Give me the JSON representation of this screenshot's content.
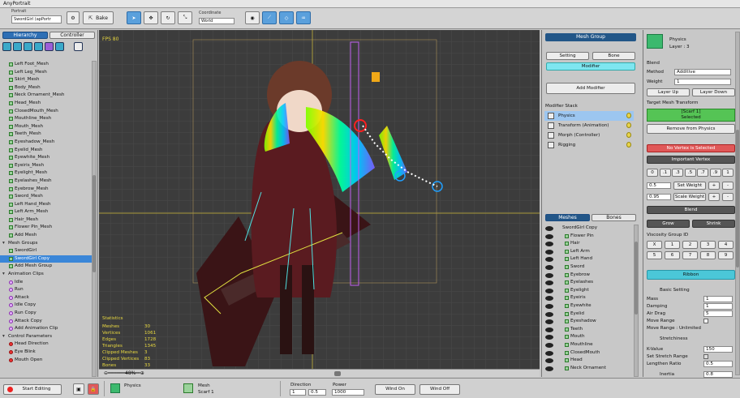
{
  "app": {
    "title": "AnyPortrait"
  },
  "toolbar": {
    "portrait_label": "Portrait",
    "portrait_value": "SwordGirl (apPortr",
    "bake_label": "Bake",
    "coordinate_label": "Coordinate",
    "coordinate_value": "World"
  },
  "left_panel": {
    "tabs": [
      "Hierarchy",
      "Controller"
    ],
    "meshes": [
      "Left Foot_Mesh",
      "Left Leg_Mesh",
      "Skirt_Mesh",
      "Body_Mesh",
      "Neck Ornament_Mesh",
      "Head_Mesh",
      "ClosedMouth_Mesh",
      "Mouthline_Mesh",
      "Mouth_Mesh",
      "Teeth_Mesh",
      "Eyeshadow_Mesh",
      "Eyelid_Mesh",
      "Eyewhite_Mesh",
      "Eyeiris_Mesh",
      "Eyelight_Mesh",
      "Eyelashes_Mesh",
      "Eyebrow_Mesh",
      "Sword_Mesh",
      "Left Hand_Mesh",
      "Left Arm_Mesh",
      "Hair_Mesh",
      "Flower Pin_Mesh",
      "Add Mesh"
    ],
    "mesh_groups_header": "Mesh Groups",
    "mesh_groups": [
      "SwordGirl",
      "SwordGirl Copy",
      "Add Mesh Group"
    ],
    "animation_header": "Animation Clips",
    "animations": [
      "Idle",
      "Run",
      "Attack",
      "Idle Copy",
      "Run Copy",
      "Attack Copy",
      "Add Animation Clip"
    ],
    "control_header": "Control Parameters",
    "controls": [
      "Head Direction",
      "Eye Blink",
      "Mouth Open"
    ]
  },
  "viewport": {
    "fps": "FPS 80",
    "zoom": "48%",
    "stats_title": "Statistics",
    "stats": [
      {
        "k": "Meshes",
        "v": "30"
      },
      {
        "k": "Vertices",
        "v": "1061"
      },
      {
        "k": "Edges",
        "v": "1728"
      },
      {
        "k": "Triangles",
        "v": "1345"
      },
      {
        "k": "Clipped Meshes",
        "v": "3"
      },
      {
        "k": "Clipped Vertices",
        "v": "83"
      },
      {
        "k": "Bones",
        "v": "33"
      }
    ]
  },
  "mid_panel": {
    "header": "Mesh Group",
    "setting_label": "Setting",
    "bone_label": "Bone",
    "modifier_label": "Modifier",
    "add_modifier_label": "Add Modifier",
    "stack_title": "Modifier Stack",
    "stack": [
      "Physics",
      "Transform (Animation)",
      "Morph (Controller)",
      "Rigging"
    ],
    "tabs": [
      "Meshes",
      "Bones"
    ],
    "tree_root": "SwordGirl Copy",
    "tree": [
      "Flower Pin",
      "Hair",
      "Left Arm",
      "Left Hand",
      "Sword",
      "Eyebrow",
      "Eyelashes",
      "Eyelight",
      "Eyeiris",
      "Eyewhite",
      "Eyelid",
      "Eyeshadow",
      "Teeth",
      "Mouth",
      "Mouthline",
      "ClosedMouth",
      "Head",
      "Neck Ornament"
    ]
  },
  "right_panel": {
    "title": "Physics",
    "layer": "Layer : 3",
    "blend_label": "Blend",
    "method_label": "Method",
    "method_value": "Additive",
    "weight_label": "Weight",
    "weight_value": "1",
    "layer_up": "Layer Up",
    "layer_down": "Layer Down",
    "target_label": "Target Mesh Transform",
    "target_value": "[Scarf 1]",
    "target_state": "Selected",
    "remove_label": "Remove from Physics",
    "no_vertex": "No Vertex is Selected",
    "important_vertex": "Important Vertex",
    "weight_steps": [
      "0",
      ".1",
      ".3",
      ".5",
      ".7",
      ".9",
      "1"
    ],
    "set_weight_value": "0.5",
    "set_weight_label": "Set Weight",
    "scale_weight_value": "0.95",
    "scale_weight_label": "Scale Weight",
    "plus": "+",
    "minus": "-",
    "blend_btn": "Blend",
    "grow_label": "Grow",
    "shrink_label": "Shrink",
    "viscosity_label": "Viscosity Group ID",
    "viscosity_ids": [
      "X",
      "1",
      "2",
      "3",
      "4",
      "5",
      "6",
      "7",
      "8",
      "9"
    ],
    "ribbon_label": "Ribbon",
    "basic_setting": "Basic Setting",
    "props": [
      {
        "k": "Mass",
        "v": "1"
      },
      {
        "k": "Damping",
        "v": "1"
      },
      {
        "k": "Air Drag",
        "v": "5"
      }
    ],
    "move_range_label": "Move Range",
    "move_range_value": "Move Range : Unlimited",
    "stretchiness": "Stretchiness",
    "kvalue_label": "K-Value",
    "kvalue": "150",
    "set_stretch_label": "Set Stretch Range",
    "lengthen_label": "Lengthen Ratio",
    "lengthen": "0.5",
    "inertia_label": "Inertia",
    "inertia": "0.8"
  },
  "bottom": {
    "start_editing": "Start Editing",
    "physics_label": "Physics",
    "mesh_label": "Mesh",
    "mesh_value": "Scarf 1",
    "direction_label": "Direction",
    "direction_x": "1",
    "direction_y": "0.5",
    "power_label": "Power",
    "power_value": "1000",
    "wind_on": "Wind On",
    "wind_off": "Wind Off"
  },
  "colors": {
    "accent": "#2e6fb5",
    "header": "#225688",
    "physics_green": "#55c455",
    "alert": "#e05858",
    "ribbon": "#4bc7d8"
  }
}
